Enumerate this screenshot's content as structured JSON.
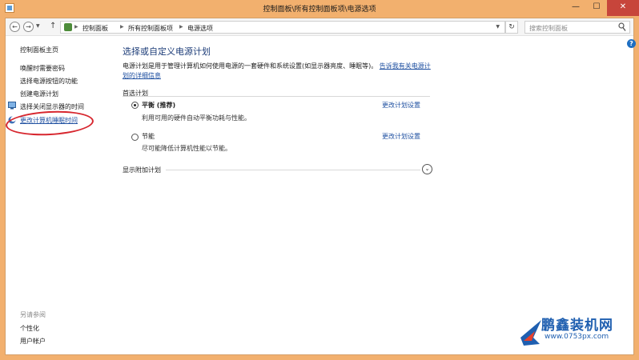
{
  "window": {
    "title": "控制面板\\所有控制面板项\\电源选项",
    "minimize_glyph": "—",
    "maximize_glyph": "☐",
    "close_glyph": "✕"
  },
  "addressbar": {
    "back_glyph": "←",
    "forward_glyph": "→",
    "history_glyph": "▼",
    "up_glyph": "↑",
    "breadcrumbs": [
      "控制面板",
      "所有控制面板项",
      "电源选项"
    ],
    "separator_glyph": "▶",
    "dropdown_glyph": "▼",
    "refresh_glyph": "↻",
    "search_placeholder": "搜索控制面板"
  },
  "help_glyph": "?",
  "sidebar": {
    "items": [
      {
        "label": "控制面板主页"
      },
      {
        "label": "唤醒时需要密码"
      },
      {
        "label": "选择电源按钮的功能"
      },
      {
        "label": "创建电源计划"
      },
      {
        "label": "选择关闭显示器的时间"
      },
      {
        "label": "更改计算机睡眠时间"
      }
    ],
    "see_also": {
      "heading": "另请参阅",
      "items": [
        {
          "label": "个性化"
        },
        {
          "label": "用户帐户"
        }
      ]
    }
  },
  "main": {
    "title": "选择或自定义电源计划",
    "description_text": "电源计划是用于管理计算机如何使用电源的一套硬件和系统设置(如显示器亮度、睡眠等)。",
    "description_link": "告诉我有关电源计划的详细信息",
    "preferred_label": "首选计划",
    "plans": [
      {
        "name": "平衡 (推荐)",
        "desc": "利用可用的硬件自动平衡功耗与性能。",
        "link": "更改计划设置",
        "selected": true
      },
      {
        "name": "节能",
        "desc": "尽可能降低计算机性能以节能。",
        "link": "更改计划设置",
        "selected": false
      }
    ],
    "more_plans_label": "显示附加计划",
    "expand_glyph": "⌄"
  },
  "watermark": {
    "name": "鹏鑫装机网",
    "url": "www.0753px.com"
  },
  "colors": {
    "frame": "#f2b06e",
    "link": "#1e4fa0",
    "title": "#1c3c78",
    "annotation": "#d7262e"
  }
}
